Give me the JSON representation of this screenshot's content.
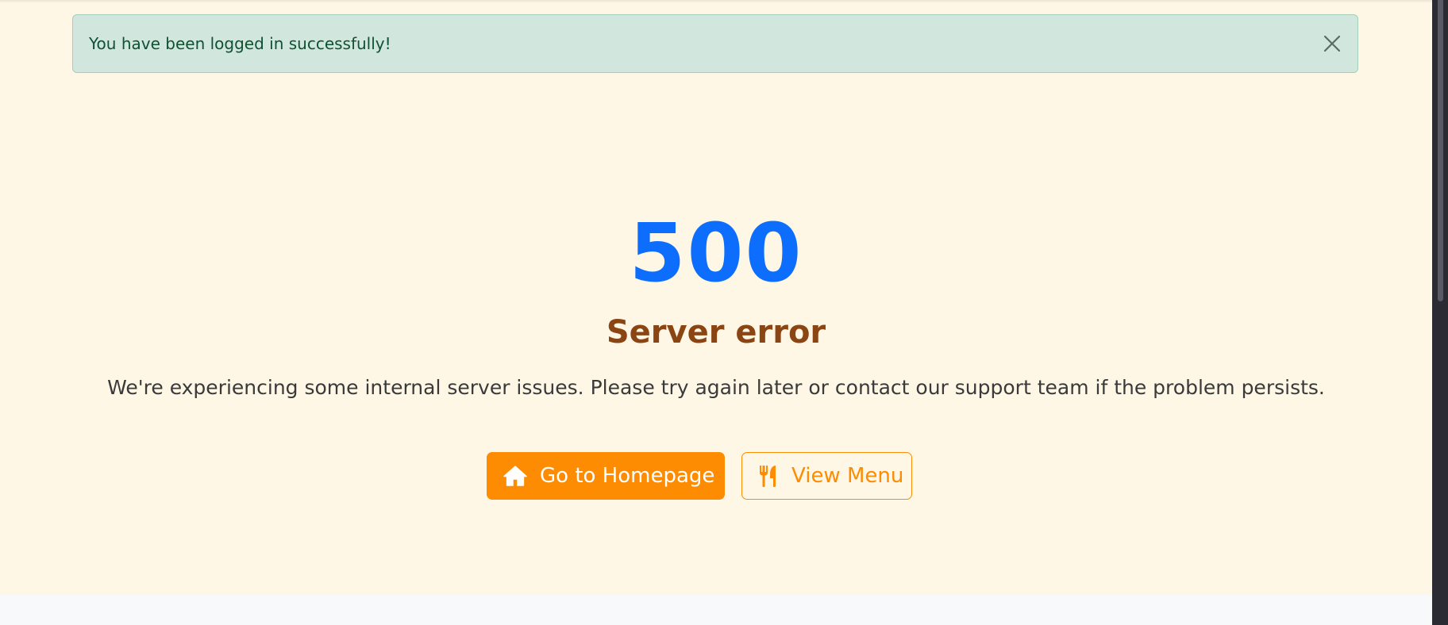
{
  "alert": {
    "message": "You have been logged in successfully!",
    "close_icon": "close-icon"
  },
  "error": {
    "code": "500",
    "title": "Server error",
    "description": "We're experiencing some internal server issues. Please try again later or contact our support team if the problem persists."
  },
  "actions": {
    "homepage_label": "Go to Homepage",
    "homepage_icon": "home-icon",
    "menu_label": "View Menu",
    "menu_icon": "utensils-icon"
  },
  "colors": {
    "page_background": "#fef7e6",
    "alert_background": "#d1e7dd",
    "alert_text": "#0f5132",
    "error_code": "#0d6efd",
    "error_title": "#8b4513",
    "accent": "#fd8c02"
  }
}
